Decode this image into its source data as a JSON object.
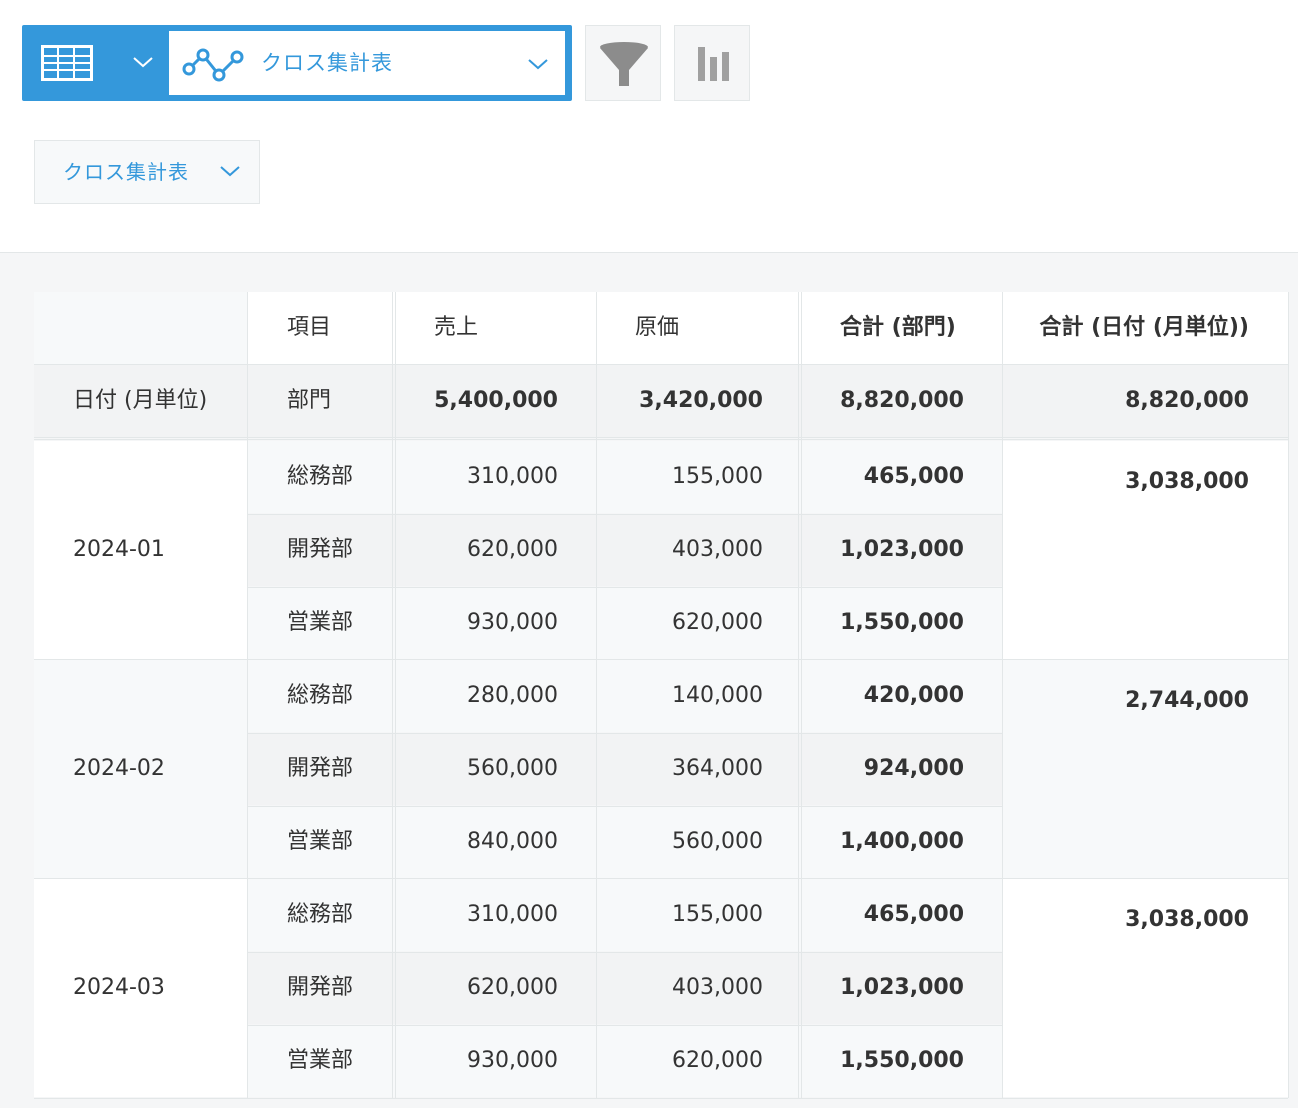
{
  "toolbar": {
    "view_select_label": "クロス集計表",
    "chart_type_label": "クロス集計表"
  },
  "table": {
    "header": {
      "item": "項目",
      "sales": "売上",
      "cost": "原価",
      "total_dept": "合計 (部門)",
      "total_date": "合計 (日付 (月単位))"
    },
    "summary": {
      "date_label": "日付 (月単位)",
      "dept_label": "部門",
      "sales": "5,400,000",
      "cost": "3,420,000",
      "total_dept": "8,820,000",
      "total_date": "8,820,000"
    },
    "groups": [
      {
        "date": "2024-01",
        "total": "3,038,000",
        "rows": [
          {
            "dept": "総務部",
            "sales": "310,000",
            "cost": "155,000",
            "total": "465,000"
          },
          {
            "dept": "開発部",
            "sales": "620,000",
            "cost": "403,000",
            "total": "1,023,000"
          },
          {
            "dept": "営業部",
            "sales": "930,000",
            "cost": "620,000",
            "total": "1,550,000"
          }
        ]
      },
      {
        "date": "2024-02",
        "total": "2,744,000",
        "rows": [
          {
            "dept": "総務部",
            "sales": "280,000",
            "cost": "140,000",
            "total": "420,000"
          },
          {
            "dept": "開発部",
            "sales": "560,000",
            "cost": "364,000",
            "total": "924,000"
          },
          {
            "dept": "営業部",
            "sales": "840,000",
            "cost": "560,000",
            "total": "1,400,000"
          }
        ]
      },
      {
        "date": "2024-03",
        "total": "3,038,000",
        "rows": [
          {
            "dept": "総務部",
            "sales": "310,000",
            "cost": "155,000",
            "total": "465,000"
          },
          {
            "dept": "開発部",
            "sales": "620,000",
            "cost": "403,000",
            "total": "1,023,000"
          },
          {
            "dept": "営業部",
            "sales": "930,000",
            "cost": "620,000",
            "total": "1,550,000"
          }
        ]
      }
    ]
  }
}
